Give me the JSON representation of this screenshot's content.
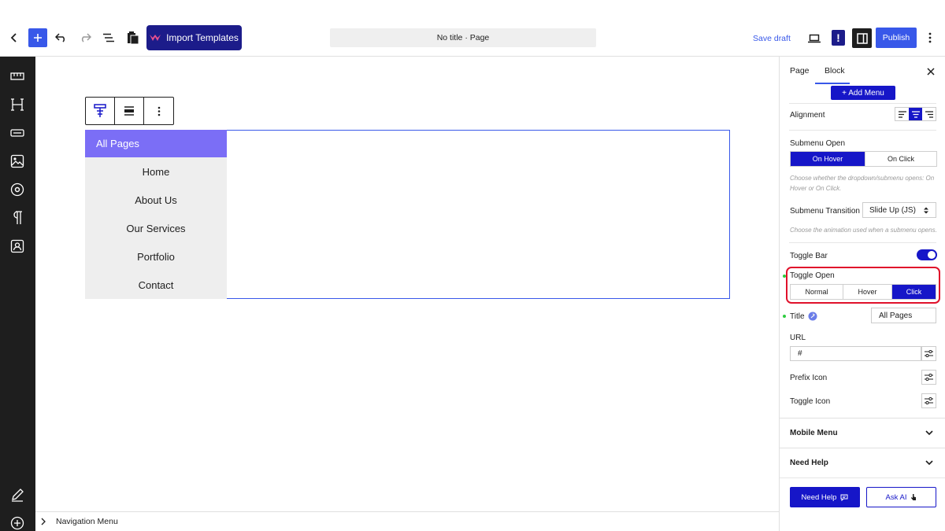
{
  "topbar": {
    "import_label": "Import Templates",
    "title": "No title · Page",
    "save_draft": "Save draft",
    "publish": "Publish",
    "accent": "#3858e9",
    "brand": "#1c1c8a"
  },
  "canvas": {
    "nav_title": "All Pages",
    "nav_items": [
      "Home",
      "About Us",
      "Our Services",
      "Portfolio",
      "Contact"
    ],
    "nav_title_bg": "#7b6ef6"
  },
  "statusbar": {
    "breadcrumb": "Navigation Menu"
  },
  "panel": {
    "tabs": {
      "page": "Page",
      "block": "Block"
    },
    "add_menu": "+ Add Menu",
    "alignment_label": "Alignment",
    "alignment_active": "center",
    "submenu_open": {
      "label": "Submenu Open",
      "options": [
        "On Hover",
        "On Click"
      ],
      "selected": "On Hover",
      "help": "Choose whether the dropdown/submenu opens: On Hover or On Click."
    },
    "submenu_transition": {
      "label": "Submenu Transition",
      "value": "Slide Up (JS)",
      "help": "Choose the animation used when a submenu opens."
    },
    "toggle_bar": {
      "label": "Toggle Bar",
      "on": true
    },
    "toggle_open": {
      "label": "Toggle Open",
      "options": [
        "Normal",
        "Hover",
        "Click"
      ],
      "selected": "Click"
    },
    "title_field": {
      "label": "Title",
      "value": "All Pages"
    },
    "url_field": {
      "label": "URL",
      "value": "#"
    },
    "prefix_icon": "Prefix Icon",
    "toggle_icon": "Toggle Icon",
    "mobile_menu": "Mobile Menu",
    "need_help_section": "Need Help",
    "need_help_button": "Need Help",
    "ask_ai_button": "Ask AI",
    "accent": "#1616c8",
    "highlight": "#e0112b"
  }
}
